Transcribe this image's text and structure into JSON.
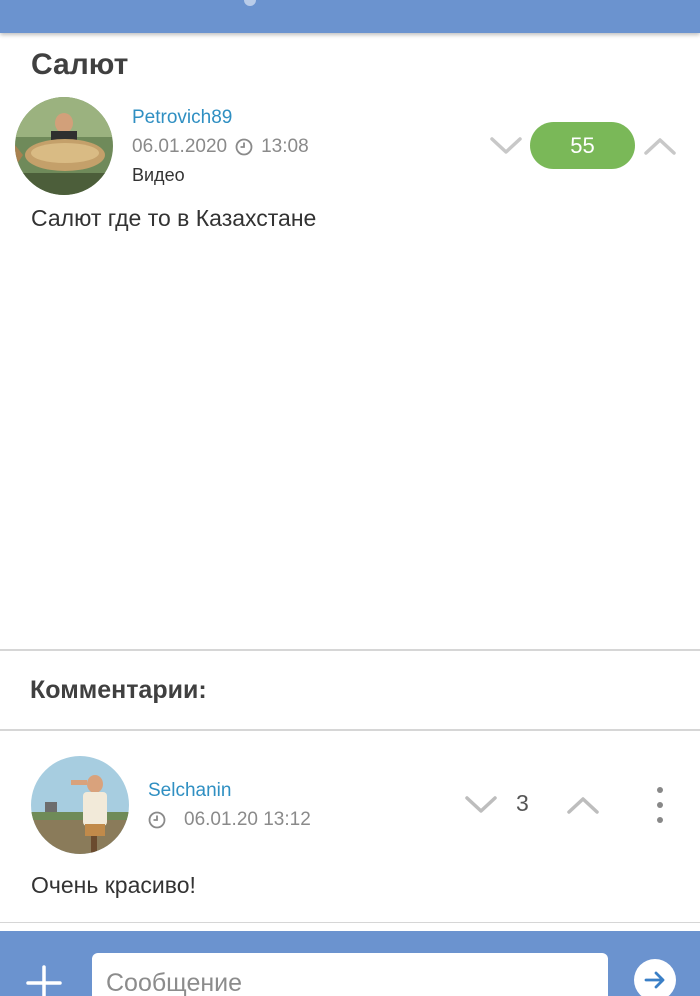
{
  "post": {
    "title": "Салют",
    "author": "Petrovich89",
    "date": "06.01.2020",
    "time": "13:08",
    "type": "Видео",
    "text": "Салют где то в Казахстане",
    "score": "55"
  },
  "comments": {
    "heading": "Комментарии:",
    "items": [
      {
        "author": "Selchanin",
        "datetime": "06.01.20 13:12",
        "score": "3",
        "text": "Очень красиво!"
      }
    ]
  },
  "composer": {
    "placeholder": "Сообщение"
  },
  "colors": {
    "accent": "#6b93cf",
    "score_green": "#7ab858",
    "username": "#2f8fc2"
  },
  "icons": [
    "clock-icon",
    "chevron-down-icon",
    "chevron-up-icon",
    "more-vertical-icon",
    "plus-icon",
    "send-arrow-icon"
  ]
}
